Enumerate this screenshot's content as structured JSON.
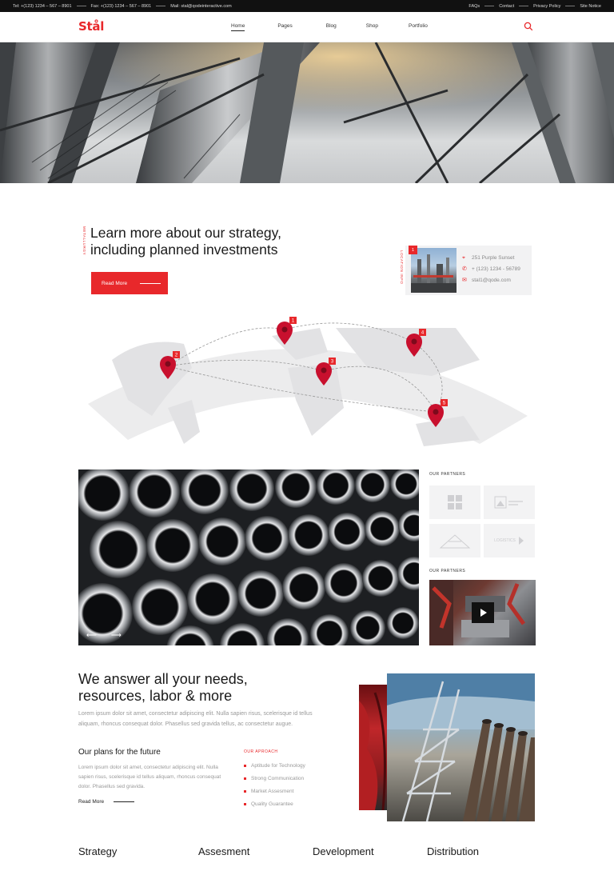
{
  "topbar": {
    "tel": "Tel: +(123) 1234 – 567 – 8901",
    "fax": "Fax: +(123) 1234 – 567 – 8901",
    "mail": "Mail: stal@qodeinteractive.com",
    "links": [
      "FAQs",
      "Contact",
      "Privacy Policy",
      "Site Notice"
    ]
  },
  "header": {
    "logo": "Stål",
    "nav": [
      "Home",
      "Pages",
      "Blog",
      "Shop",
      "Portfolio"
    ],
    "active_nav": "Home",
    "search_icon": "search-icon"
  },
  "strategy": {
    "vertical_label": "METALLURGY",
    "title_line1": "Learn more about our strategy,",
    "title_line2": "including planned investments",
    "button": "Read More"
  },
  "location": {
    "vertical_label": "LOCATION INFO",
    "badge": "1",
    "address": "251 Purple Sunset",
    "phone": "+ (123) 1234 - 56789",
    "email": "stal1@qode.com"
  },
  "map": {
    "pins": [
      "1",
      "2",
      "3",
      "4",
      "5"
    ]
  },
  "partners": {
    "label": "OUR PARTNERS",
    "logos": [
      "partner-logo-1",
      "partner-logo-2",
      "partner-logo-3",
      "LOGISTICS"
    ],
    "video_label": "OUR PARTNERS"
  },
  "slider": {
    "prev": "⟵",
    "next": "⟶"
  },
  "needs": {
    "title_line1": "We answer all your needs,",
    "title_line2": "resources, labor & more",
    "text": "Lorem ipsum dolor sit amet, consectetur adipiscing elit. Nulla sapien risus, scelerisque id tellus aliquam, rhoncus consequat dolor. Phasellus sed gravida tellus, ac consectetur augue.",
    "plans_title": "Our plans for the future",
    "plans_text": "Lorem ipsum dolor sit amet, consectetur adipiscing elit. Nulla sapien risus, scelerisque id tellus aliquam, rhoncus consequat dolor. Phasellus sed gravida.",
    "plans_link": "Read More",
    "approach_label": "OUR APROACH",
    "approach_items": [
      "Aptitude for Technology",
      "Strong Communication",
      "Market Assesment",
      "Quality Guarantee"
    ]
  },
  "services": [
    "Strategy",
    "Assesment",
    "Development",
    "Distribution"
  ]
}
